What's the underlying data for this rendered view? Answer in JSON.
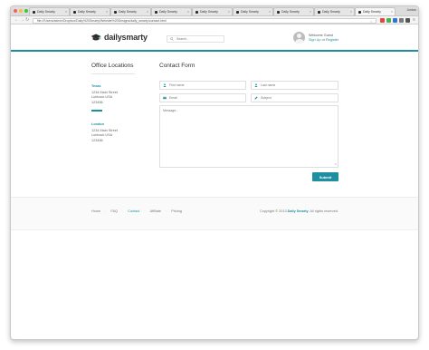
{
  "browser": {
    "tabs": [
      {
        "label": "Daily Smarty",
        "active": false
      },
      {
        "label": "Daily Smarty",
        "active": false
      },
      {
        "label": "Daily Smarty",
        "active": false
      },
      {
        "label": "Daily Smarty",
        "active": false
      },
      {
        "label": "Daily Smarty",
        "active": false
      },
      {
        "label": "Daily Smarty",
        "active": false
      },
      {
        "label": "Daily Smarty",
        "active": false
      },
      {
        "label": "Daily Smarty",
        "active": false
      },
      {
        "label": "Daily Smarty",
        "active": true
      }
    ],
    "profile": "Jordan",
    "url": "file:///Users/admin/Dropbox/Daily%20Smarty/Website%20Designs/daily_smarty/contact.html"
  },
  "header": {
    "logo_text": "dailysmarty",
    "search_placeholder": "Search...",
    "welcome": "Welcome Guest",
    "sign_up": "Sign Up",
    "or": "or",
    "register": "Register"
  },
  "offices": {
    "title": "Office Locations",
    "locations": [
      {
        "name": "Texas",
        "street": "1234 Main Street",
        "city": "Lubbock USA",
        "zip": "123456"
      },
      {
        "name": "London",
        "street": "1234 Main Street",
        "city": "Lubbock USA",
        "zip": "123456"
      }
    ]
  },
  "contact": {
    "title": "Contact Form",
    "first_name_placeholder": "First name",
    "last_name_placeholder": "Last name",
    "email_placeholder": "Email",
    "subject_placeholder": "Subject",
    "message_placeholder": "Message...",
    "submit_label": "Submit"
  },
  "footer": {
    "links": [
      {
        "label": "Home",
        "active": false
      },
      {
        "label": "FAQ",
        "active": false
      },
      {
        "label": "Contact",
        "active": true
      },
      {
        "label": "Affiliate",
        "active": false
      },
      {
        "label": "Pricing",
        "active": false
      }
    ],
    "copyright_prefix": "Copyright © 2013",
    "copyright_brand": "Daily Smarty",
    "copyright_suffix": ". All rights reserved."
  },
  "colors": {
    "accent": "#1e8fa0"
  }
}
